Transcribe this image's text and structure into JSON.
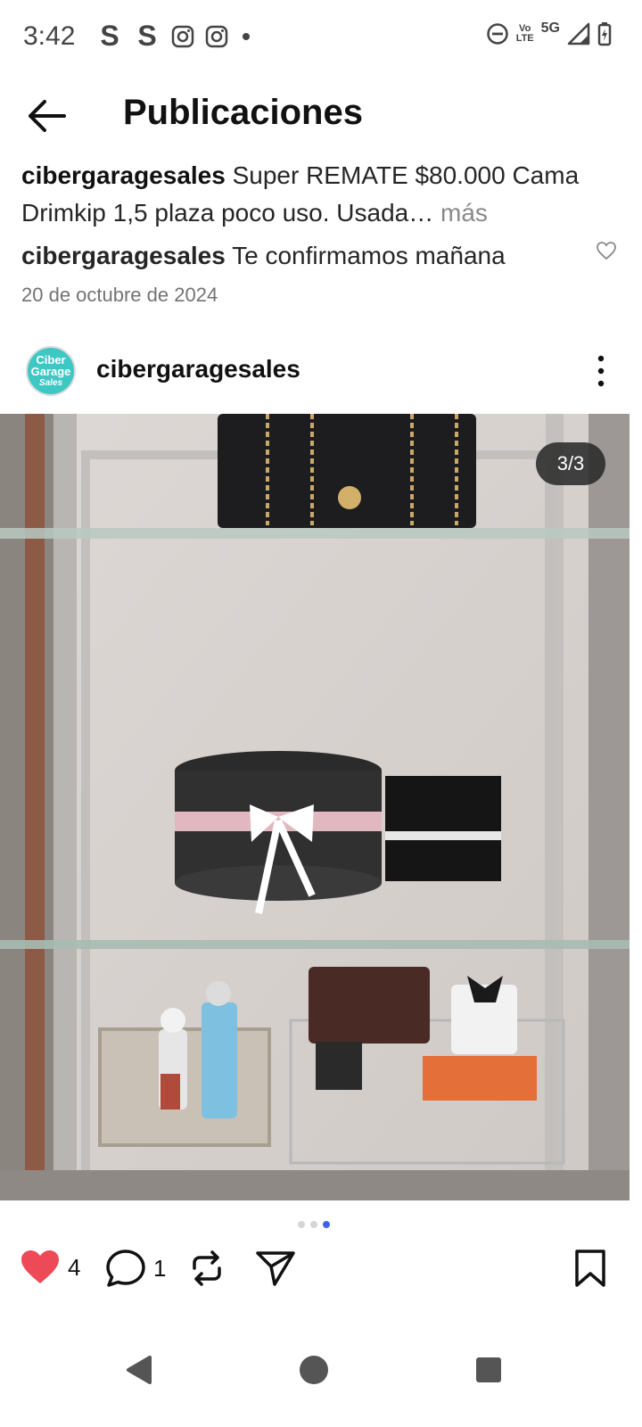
{
  "status_bar": {
    "time": "3:42",
    "left_icons": [
      "S",
      "S",
      "instagram-icon",
      "instagram-icon",
      "dot"
    ],
    "right_labels": {
      "volte_top": "Vo",
      "volte_bottom": "LTE",
      "network": "5G"
    }
  },
  "header": {
    "title": "Publicaciones",
    "back_icon": "arrow-left-icon"
  },
  "caption": {
    "username": "cibergaragesales",
    "text": "Super REMATE $80.000 Cama Drimkip 1,5 plaza poco uso. Usada…",
    "more": "más"
  },
  "comment": {
    "username": "cibergaragesales",
    "text": "Te confirmamos mañana"
  },
  "date": "20 de octubre de 2024",
  "post": {
    "username": "cibergaragesales",
    "avatar_text": [
      "Ciber",
      "Garage",
      "Sales"
    ],
    "image_counter": "3/3",
    "carousel": {
      "total": 3,
      "current": 3
    }
  },
  "actions": {
    "likes": "4",
    "comments": "1",
    "liked": true,
    "colors": {
      "heart": "#ed4956",
      "dot_active": "#3f63e8"
    }
  },
  "nav": {
    "icons": [
      "back-triangle-icon",
      "home-circle-icon",
      "recents-square-icon"
    ]
  }
}
